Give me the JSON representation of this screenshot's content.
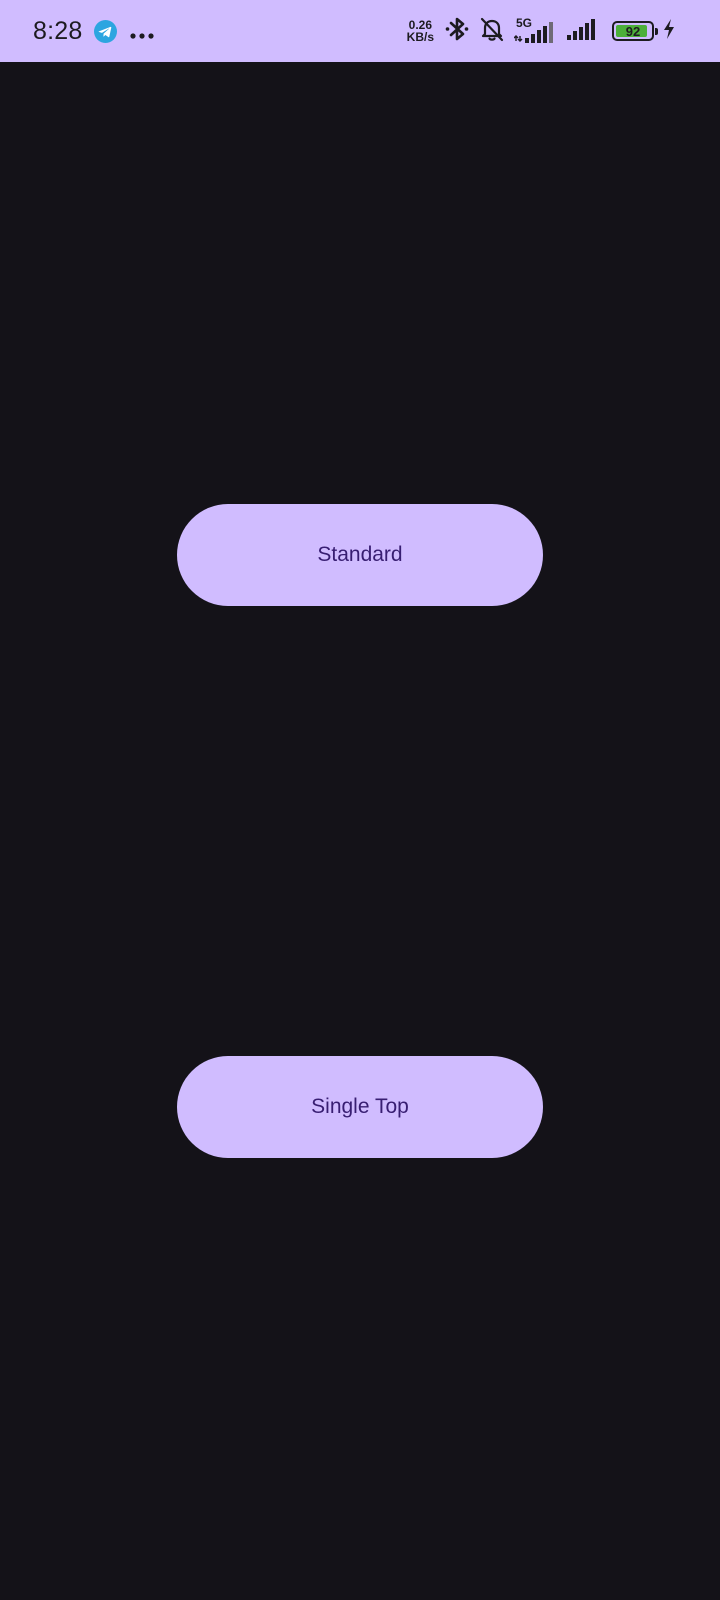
{
  "status_bar": {
    "time": "8:28",
    "net_speed_value": "0.26",
    "net_speed_unit": "KB/s",
    "network_type": "5G",
    "battery_level": 92,
    "battery_level_text": "92",
    "background_color": "#d0bcff",
    "battery_color": "#4caf3a",
    "icons": [
      "telegram-icon",
      "more-dots-icon",
      "bluetooth-icon",
      "bell-off-icon",
      "signal-5g-icon",
      "signal-icon",
      "battery-icon",
      "charging-icon"
    ]
  },
  "main": {
    "background_color": "#141218",
    "buttons": {
      "standard_label": "Standard",
      "single_top_label": "Single Top"
    },
    "button_color": "#d0bcff",
    "button_text_color": "#381e72"
  }
}
